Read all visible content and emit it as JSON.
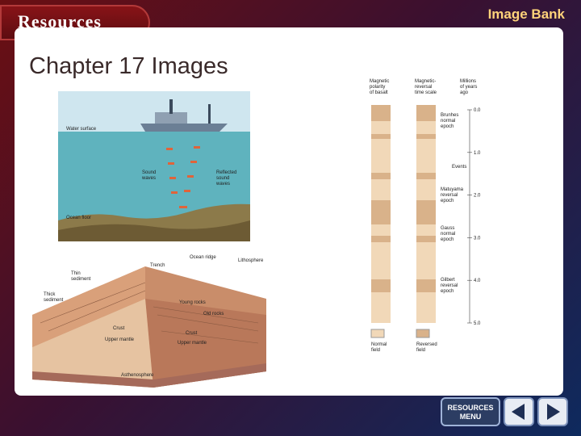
{
  "header": {
    "resources_label": "Resources",
    "section_title": "Image Bank"
  },
  "main": {
    "chapter_title": "Chapter 17 Images",
    "figure_sonar": {
      "labels": {
        "water_surface": "Water surface",
        "sound_waves": "Sound\nwaves",
        "reflected": "Reflected\nsound\nwaves",
        "ocean_floor": "Ocean floor"
      }
    },
    "figure_ridge": {
      "labels": {
        "ocean_ridge": "Ocean ridge",
        "lithosphere": "Lithosphere",
        "trench": "Trench",
        "thin_sediment": "Thin\nsediment",
        "thick_sediment": "Thick\nsediment",
        "young_rocks": "Young rocks",
        "old_rocks": "Old rocks",
        "crust_left": "Crust",
        "crust_right": "Crust",
        "upper_mantle_left": "Upper mantle",
        "upper_mantle_right": "Upper mantle",
        "asthenosphere": "Asthenosphere"
      }
    },
    "figure_polarity": {
      "headers": {
        "col1": "Magnetic\npolarity\nof basalt",
        "col2": "Magnetic-\nreversal\ntime scale",
        "col3": "Millions\nof years\nago"
      },
      "ticks": [
        "0.0",
        "1.0",
        "2.0",
        "3.0",
        "4.0",
        "5.0"
      ],
      "epochs": {
        "brunhes": "Brunhes\nnormal\nepoch",
        "events": "Events",
        "matuyama": "Matuyama\nreversal\nepoch",
        "gauss": "Gauss\nnormal\nepoch",
        "gilbert": "Gilbert\nreversal\nepoch"
      },
      "legend": {
        "normal": "Normal\nfield",
        "reversed": "Reversed\nfield"
      }
    }
  },
  "nav": {
    "menu_line1": "RESOURCES",
    "menu_line2": "MENU",
    "prev_icon": "left-triangle-icon",
    "next_icon": "right-triangle-icon"
  }
}
